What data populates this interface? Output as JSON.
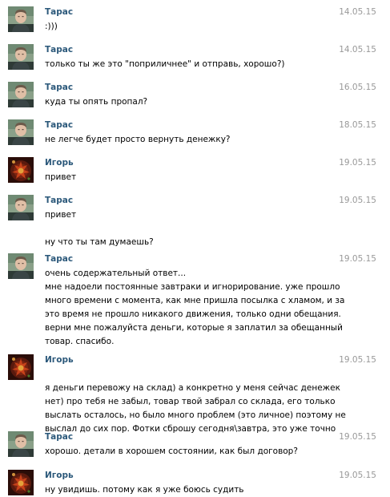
{
  "chat": {
    "messages": [
      {
        "author": "Тарас",
        "avatar": "taras",
        "date": "14.05.15",
        "lines": [
          ":)))"
        ]
      },
      {
        "author": "Тарас",
        "avatar": "taras",
        "date": "14.05.15",
        "lines": [
          "только ты же это \"поприличнее\" и отправь, хорошо?)"
        ]
      },
      {
        "author": "Тарас",
        "avatar": "taras",
        "date": "16.05.15",
        "lines": [
          "куда ты опять пропал?"
        ]
      },
      {
        "author": "Тарас",
        "avatar": "taras",
        "date": "18.05.15",
        "lines": [
          "не легче будет просто вернуть денежку?"
        ]
      },
      {
        "author": "Игорь",
        "avatar": "igor",
        "date": "19.05.15",
        "lines": [
          "привет"
        ]
      },
      {
        "author": "Тарас",
        "avatar": "taras",
        "date": "19.05.15",
        "lines": [
          "привет",
          "",
          "ну что ты там думаешь?"
        ]
      },
      {
        "author": "Тарас",
        "avatar": "taras",
        "date": "19.05.15",
        "lines": [
          "очень содержательный ответ...",
          "мне надоели постоянные завтраки и игнорирование. уже прошло",
          "много времени с момента, как мне пришла посылка с хламом, и за",
          "это время не прошло никакого движения, только одни обещания.",
          "верни мне пожалуйста деньги, которые я заплатил за обещанный",
          "товар. спасибо."
        ]
      },
      {
        "author": "Игорь",
        "avatar": "igor",
        "date": "19.05.15",
        "lines": [
          "",
          "я деньги перевожу на склад) а конкретно у меня сейчас денежек",
          "нет) про тебя не забыл, товар твой забрал со склада, его только",
          "выслать осталось, но было много проблем (это личное) поэтому не",
          "выслал до сих пор. Фотки сброшу сегодня\\завтра, это уже точно"
        ]
      },
      {
        "author": "Тарас",
        "avatar": "taras",
        "date": "19.05.15",
        "lines": [
          "хорошо. детали в хорошем состоянии, как был договор?"
        ]
      },
      {
        "author": "Игорь",
        "avatar": "igor",
        "date": "19.05.15",
        "lines": [
          "ну увидишь. потому как я уже боюсь судить"
        ]
      }
    ]
  },
  "colors": {
    "author": "#2b587a",
    "date": "#999999",
    "text": "#000000"
  }
}
